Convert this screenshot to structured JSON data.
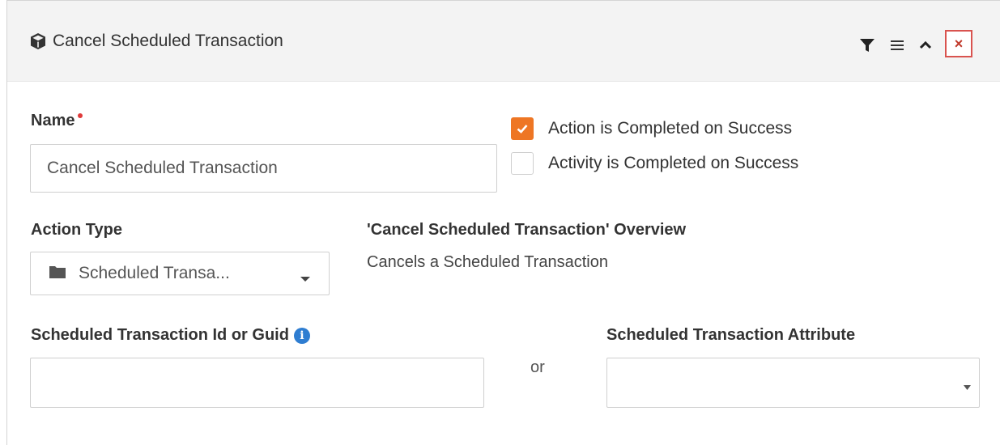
{
  "header": {
    "title": "Cancel Scheduled Transaction",
    "title_icon": "cube-icon",
    "icons": [
      "filter-icon",
      "menu-icon",
      "chevron-up-icon",
      "close-icon"
    ],
    "close_glyph": "×"
  },
  "form": {
    "name": {
      "label": "Name",
      "value": "Cancel Scheduled Transaction",
      "required": true
    },
    "checkboxes": [
      {
        "label": "Action is Completed on Success",
        "checked": true
      },
      {
        "label": "Activity is Completed on Success",
        "checked": false
      }
    ],
    "action_type": {
      "label": "Action Type",
      "value": "Scheduled Transa...",
      "icon": "folder-icon"
    },
    "overview": {
      "title": "'Cancel Scheduled Transaction' Overview",
      "text": "Cancels a Scheduled Transaction"
    },
    "transaction_id": {
      "label": "Scheduled Transaction Id or Guid",
      "value": "",
      "info_glyph": "i"
    },
    "or_text": "or",
    "transaction_attribute": {
      "label": "Scheduled Transaction Attribute",
      "value": ""
    }
  },
  "colors": {
    "accent": "#ee7624",
    "required": "#e03a3a",
    "close": "#d9534f",
    "info": "#2e7dd1",
    "header_bg": "#f3f3f3"
  }
}
